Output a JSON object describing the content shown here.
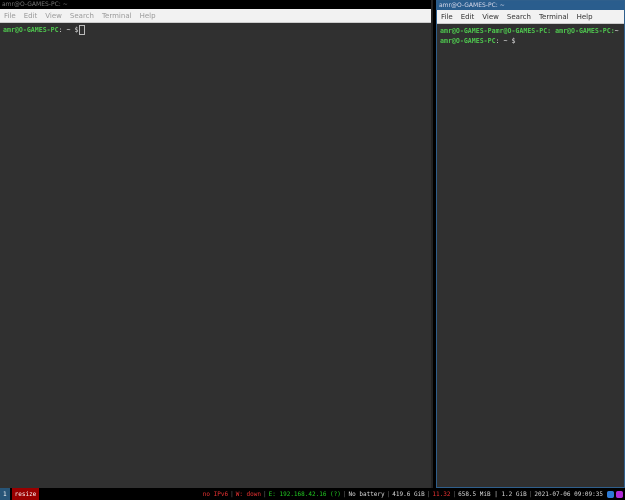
{
  "left_window": {
    "title": "amr@O-GAMES-PC: ~",
    "menu": [
      "File",
      "Edit",
      "View",
      "Search",
      "Terminal",
      "Help"
    ],
    "lines": [
      {
        "user": "amr@O-GAMES-PC",
        "path": ": ~",
        "symbol": "$"
      }
    ]
  },
  "right_window": {
    "title": "amr@O-GAMES-PC: ~",
    "menu": [
      "File",
      "Edit",
      "View",
      "Search",
      "Terminal",
      "Help"
    ],
    "lines": [
      {
        "user": "amr@O-GAMES-Pamr@O-GAMES-PC: amr@O-GAMES-PC:",
        "path": "~",
        "symbol": ""
      },
      {
        "user": "amr@O-GAMES-PC",
        "path": ": ~",
        "symbol": "$"
      }
    ]
  },
  "statusbar": {
    "workspace": "1",
    "mode": "resize",
    "ipv6": "no IPv6",
    "wifi": "W: down",
    "eth": "E: 192.168.42.16 (?)",
    "battery": "No battery",
    "disk": "419.6 GiB",
    "load": "11.32",
    "mem": "658.5 MiB | 1.2 GiB",
    "datetime": "2021-07-06 09:09:35"
  },
  "colors": {
    "prompt": "#4ec64e",
    "background": "#303030",
    "focused_title": "#2a5d8d",
    "mode": "#990000"
  }
}
